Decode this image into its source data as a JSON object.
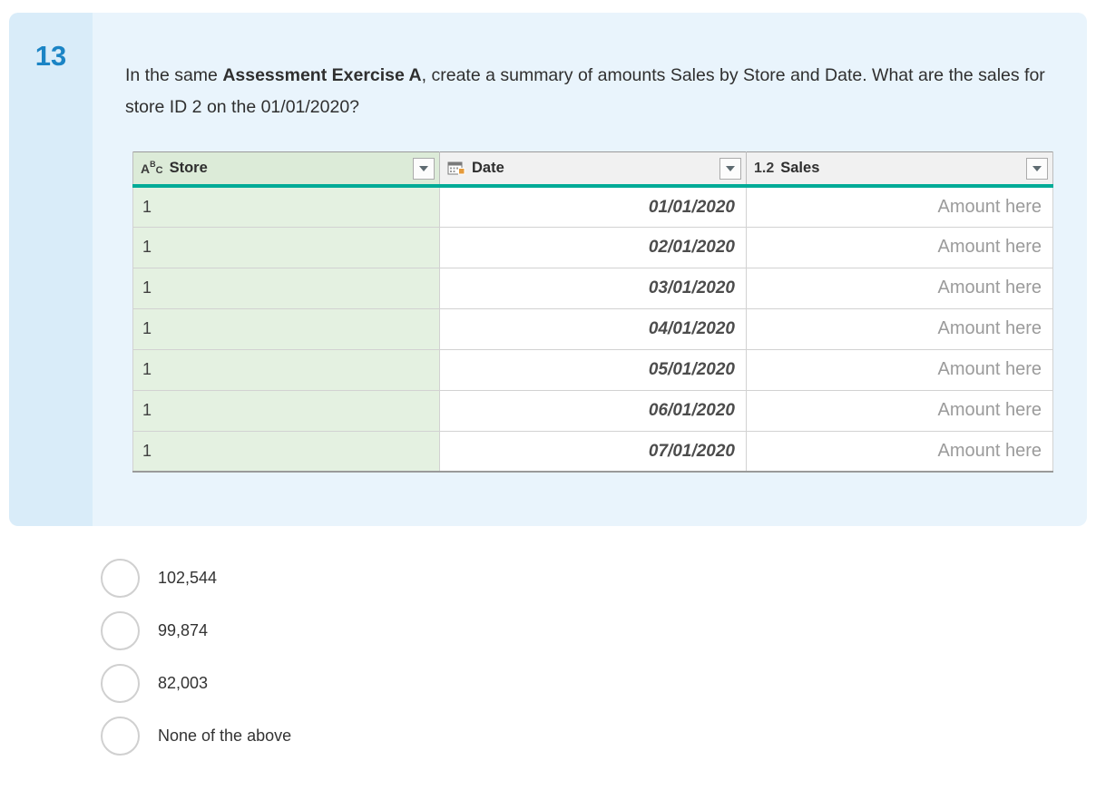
{
  "question": {
    "number": "13",
    "text_prefix": "In the same ",
    "text_bold": "Assessment Exercise A",
    "text_suffix": ", create a summary of amounts Sales by Store and Date. What are the sales for store ID 2 on the 01/01/2020?"
  },
  "table": {
    "columns": [
      {
        "icon": "abc-type-icon",
        "type_letters": [
          "A",
          "B",
          "C"
        ],
        "label": "Store"
      },
      {
        "icon": "calendar-type-icon",
        "label": "Date"
      },
      {
        "icon": "number-type-icon",
        "type_text": "1.2",
        "label": "Sales"
      }
    ],
    "rows": [
      {
        "store": "1",
        "date": "01/01/2020",
        "sales": "Amount here"
      },
      {
        "store": "1",
        "date": "02/01/2020",
        "sales": "Amount here"
      },
      {
        "store": "1",
        "date": "03/01/2020",
        "sales": "Amount here"
      },
      {
        "store": "1",
        "date": "04/01/2020",
        "sales": "Amount here"
      },
      {
        "store": "1",
        "date": "05/01/2020",
        "sales": "Amount here"
      },
      {
        "store": "1",
        "date": "06/01/2020",
        "sales": "Amount here"
      },
      {
        "store": "1",
        "date": "07/01/2020",
        "sales": "Amount here"
      }
    ]
  },
  "options": [
    {
      "label": "102,544"
    },
    {
      "label": "99,874"
    },
    {
      "label": "82,003"
    },
    {
      "label": "None of the above"
    }
  ],
  "colors": {
    "accent_teal": "#00ab97",
    "question_number_blue": "#1b84c5",
    "card_bg": "#e9f4fc",
    "card_strip_bg": "#d9ecf9",
    "store_column_bg": "#e4f1e1"
  }
}
